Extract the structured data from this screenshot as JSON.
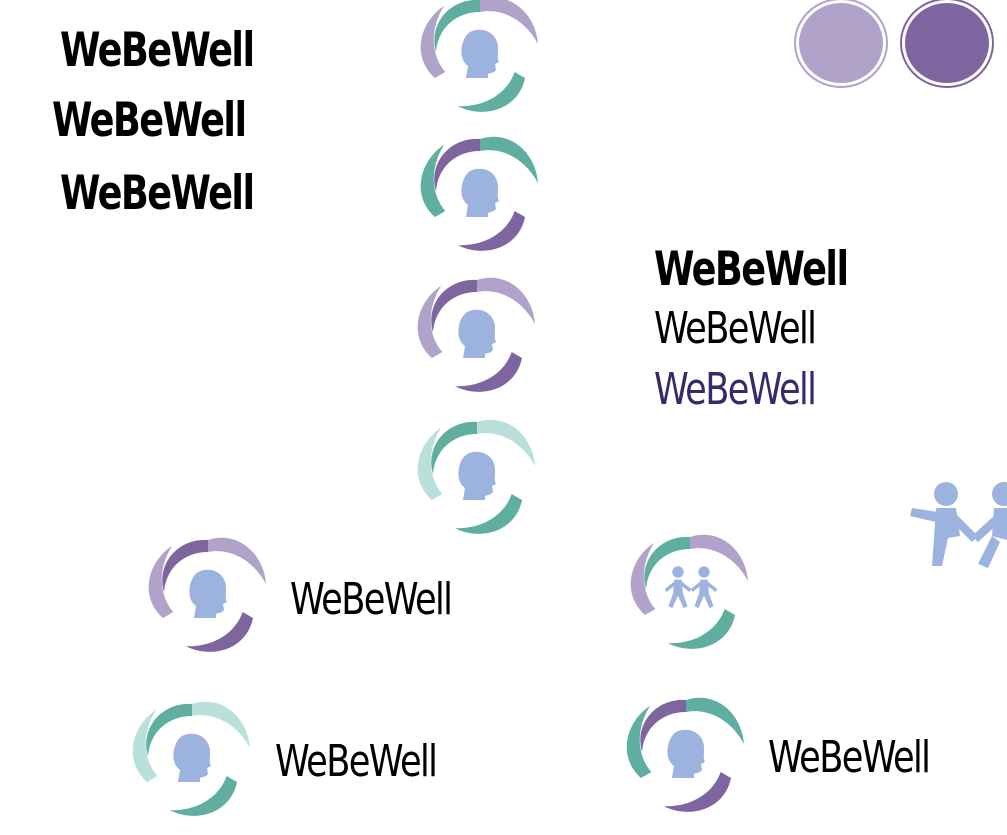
{
  "brand": {
    "wordmark": "WeBeWell"
  },
  "colors": {
    "black": "#000000",
    "navy": "#352b6b",
    "teal": "#5fae9f",
    "teal_light": "#b9e0da",
    "purple": "#7f659f",
    "lavender": "#b1a2c9",
    "head_blue": "#9cb3df",
    "swatch_light": "#b1a2c9",
    "swatch_dark": "#7f659f"
  },
  "wordmarks": [
    {
      "text": "WeBeWell",
      "weight": "heavy",
      "color": "#000000"
    },
    {
      "text": "WeBeWell",
      "weight": "heavy",
      "color": "#000000"
    },
    {
      "text": "WeBeWell",
      "weight": "heavy",
      "color": "#000000"
    },
    {
      "text": "WeBeWell",
      "weight": "heavy",
      "color": "#000000"
    },
    {
      "text": "WeBeWell",
      "weight": "light",
      "color": "#000000"
    },
    {
      "text": "WeBeWell",
      "weight": "light",
      "color": "#352b6b"
    }
  ],
  "lockups": [
    {
      "text": "WeBeWell",
      "icon": "head-swirl-icon",
      "scheme": "purple-lavender"
    },
    {
      "text": "WeBeWell",
      "icon": "head-swirl-icon",
      "scheme": "teal-lightteal"
    },
    {
      "text": "WeBeWell",
      "icon": "head-swirl-icon",
      "scheme": "teal-purple"
    }
  ],
  "icons": [
    {
      "name": "head-swirl-icon",
      "scheme": "lavender-teal"
    },
    {
      "name": "head-swirl-icon",
      "scheme": "teal-purple"
    },
    {
      "name": "head-swirl-icon",
      "scheme": "lavender-purple"
    },
    {
      "name": "head-swirl-icon",
      "scheme": "lightteal-teal"
    },
    {
      "name": "children-swirl-icon",
      "scheme": "lavender-teal"
    },
    {
      "name": "children-holding-hands-icon",
      "scheme": "blue"
    }
  ]
}
